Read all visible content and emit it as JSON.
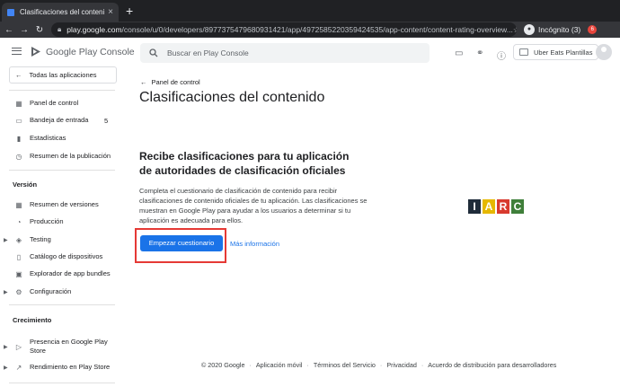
{
  "browser": {
    "tab_title": "Clasificaciones del contenido",
    "url_host": "play.google.com",
    "url_path": "/console/u/0/developers/8977375479680931421/app/4972585220359424535/app-content/content-rating-overview...",
    "profile_label": "Incógnito (3)",
    "badge": "6"
  },
  "header": {
    "brand": "Google Play Console",
    "search_placeholder": "Buscar en Play Console",
    "account": "Uber Eats Plantillas"
  },
  "sidebar": {
    "all_apps": "Todas las aplicaciones",
    "items": [
      {
        "label": "Panel de control",
        "icon": "dashboard-icon"
      },
      {
        "label": "Bandeja de entrada",
        "icon": "inbox-icon",
        "count": "5"
      },
      {
        "label": "Estadísticas",
        "icon": "bar-chart-icon"
      },
      {
        "label": "Resumen de la publicación",
        "icon": "publishing-icon"
      }
    ],
    "section_release": "Versión",
    "release_items": [
      {
        "label": "Resumen de versiones",
        "icon": "releases-icon"
      },
      {
        "label": "Producción",
        "icon": "production-icon"
      },
      {
        "label": "Testing",
        "icon": "testing-icon"
      },
      {
        "label": "Catálogo de dispositivos",
        "icon": "devices-icon"
      },
      {
        "label": "Explorador de app bundles",
        "icon": "bundle-icon"
      },
      {
        "label": "Configuración",
        "icon": "gear-icon"
      }
    ],
    "section_growth": "Crecimiento",
    "growth_items": [
      {
        "label": "Presencia en Google Play Store",
        "icon": "store-presence-icon"
      },
      {
        "label": "Rendimiento en Play Store",
        "icon": "trending-icon"
      }
    ]
  },
  "main": {
    "back_label": "Panel de control",
    "title": "Clasificaciones del contenido",
    "heading": "Recibe clasificaciones para tu aplicación de autoridades de clasificación oficiales",
    "description": "Completa el cuestionario de clasificación de contenido para recibir clasificaciones de contenido oficiales de tu aplicación. Las clasificaciones se muestran en Google Play para ayudar a los usuarios a determinar si tu aplicación es adecuada para ellos.",
    "start_button": "Empezar cuestionario",
    "more_link": "Más información",
    "iarc_letters": [
      "I",
      "A",
      "R",
      "C"
    ],
    "iarc_colors": [
      "#1f2c3a",
      "#e6b800",
      "#d83a2e",
      "#3f7f3a"
    ]
  },
  "footer": {
    "copyright": "© 2020 Google",
    "links": [
      "Aplicación móvil",
      "Términos del Servicio",
      "Privacidad",
      "Acuerdo de distribución para desarrolladores"
    ]
  },
  "colors": {
    "accent": "#1a73e8",
    "highlight_box": "#e53935"
  }
}
